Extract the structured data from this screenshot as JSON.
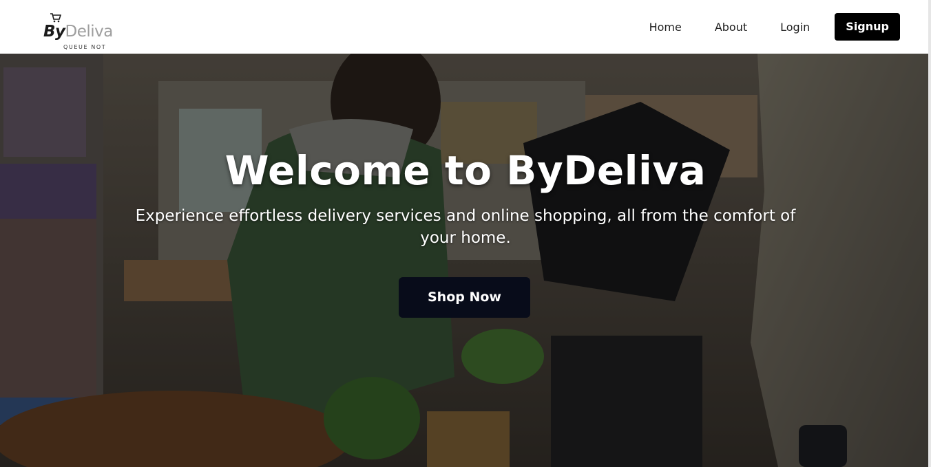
{
  "brand": {
    "name_bold": "By",
    "name_light": "Deliva",
    "tagline": "QUEUE NOT",
    "icon": "cart-icon"
  },
  "nav": {
    "items": [
      {
        "label": "Home"
      },
      {
        "label": "About"
      },
      {
        "label": "Login"
      }
    ],
    "signup_label": "Signup"
  },
  "hero": {
    "title": "Welcome to ByDeliva",
    "subtitle": "Experience effortless delivery services and online shopping, all from the comfort of your home.",
    "cta_label": "Shop Now",
    "background": "grocery-checkout-photo"
  },
  "colors": {
    "nav_bg": "#ffffff",
    "signup_bg": "#000000",
    "cta_bg": "#080c1a",
    "text_light": "#ffffff"
  }
}
